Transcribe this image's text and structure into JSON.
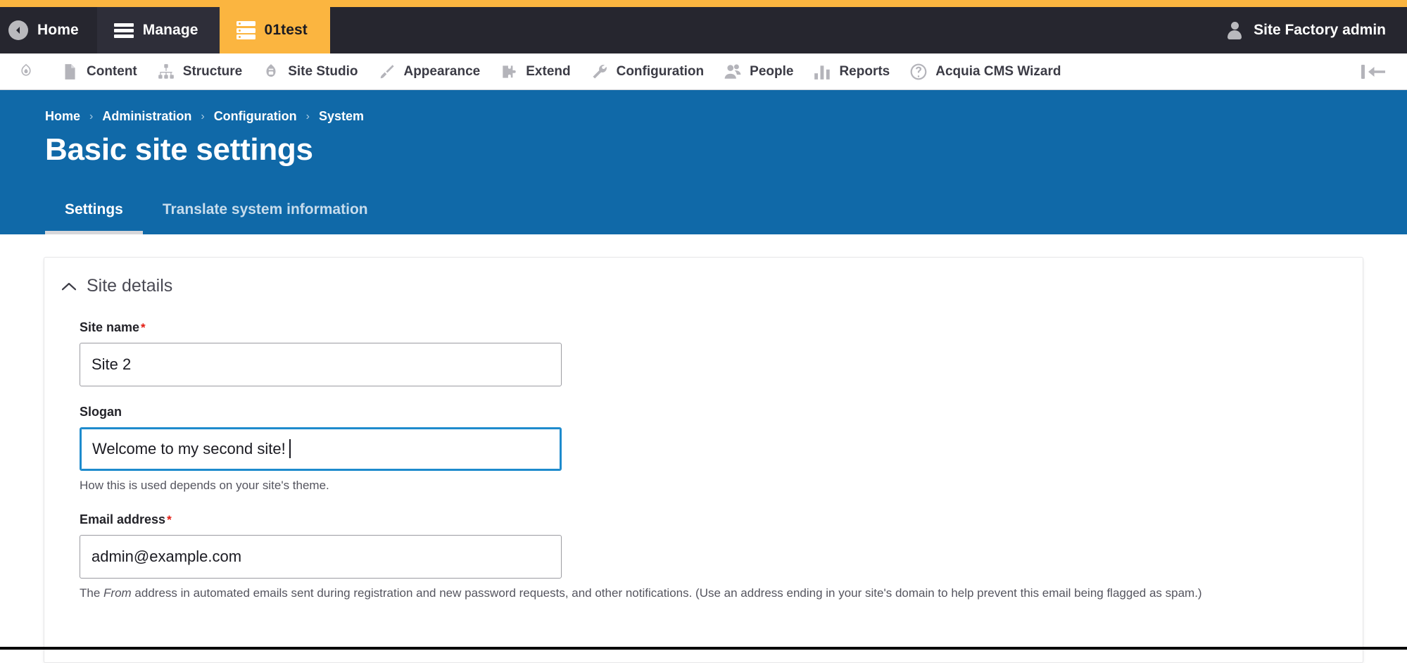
{
  "colors": {
    "accent_orange": "#fbb540",
    "toolbar_dark": "#26262f",
    "header_blue": "#1069a8",
    "focus_blue": "#1e8bcd",
    "required_red": "#e3190f"
  },
  "toolbar_primary": {
    "home_label": "Home",
    "home_icon": "back-circle-icon",
    "manage_label": "Manage",
    "manage_icon": "hamburger-icon",
    "site_label": "01test",
    "site_icon": "server-icon",
    "user_label": "Site Factory admin",
    "user_icon": "user-avatar-icon"
  },
  "toolbar_secondary": {
    "logo_icon": "drupal-droplet-icon",
    "items": [
      {
        "label": "Content",
        "icon": "document-icon"
      },
      {
        "label": "Structure",
        "icon": "sitemap-icon"
      },
      {
        "label": "Site Studio",
        "icon": "droplet-icon"
      },
      {
        "label": "Appearance",
        "icon": "paintbrush-icon"
      },
      {
        "label": "Extend",
        "icon": "puzzle-piece-icon"
      },
      {
        "label": "Configuration",
        "icon": "wrench-icon"
      },
      {
        "label": "People",
        "icon": "people-icon"
      },
      {
        "label": "Reports",
        "icon": "bar-chart-icon"
      },
      {
        "label": "Acquia CMS Wizard",
        "icon": "question-circle-icon"
      }
    ],
    "orientation_toggle_icon": "collapse-left-icon"
  },
  "page_header": {
    "breadcrumb": [
      {
        "label": "Home"
      },
      {
        "label": "Administration"
      },
      {
        "label": "Configuration"
      },
      {
        "label": "System"
      }
    ],
    "separator": "›",
    "title": "Basic site settings",
    "tabs": [
      {
        "label": "Settings",
        "active": true
      },
      {
        "label": "Translate system information",
        "active": false
      }
    ]
  },
  "form": {
    "section": {
      "title": "Site details",
      "collapse_icon": "chevron-up-icon"
    },
    "fields": [
      {
        "label": "Site name",
        "required": true,
        "value": "Site 2",
        "placeholder": "",
        "description": "",
        "focused": false
      },
      {
        "label": "Slogan",
        "required": false,
        "value": "Welcome to my second site!",
        "placeholder": "",
        "description": "How this is used depends on your site's theme.",
        "focused": true
      },
      {
        "label": "Email address",
        "required": true,
        "value": "admin@example.com",
        "placeholder": "",
        "description_prefix": "The ",
        "description_em": "From",
        "description_suffix": " address in automated emails sent during registration and new password requests, and other notifications. (Use an address ending in your site's domain to help prevent this email being flagged as spam.)",
        "focused": false
      }
    ],
    "required_marker": "*"
  }
}
